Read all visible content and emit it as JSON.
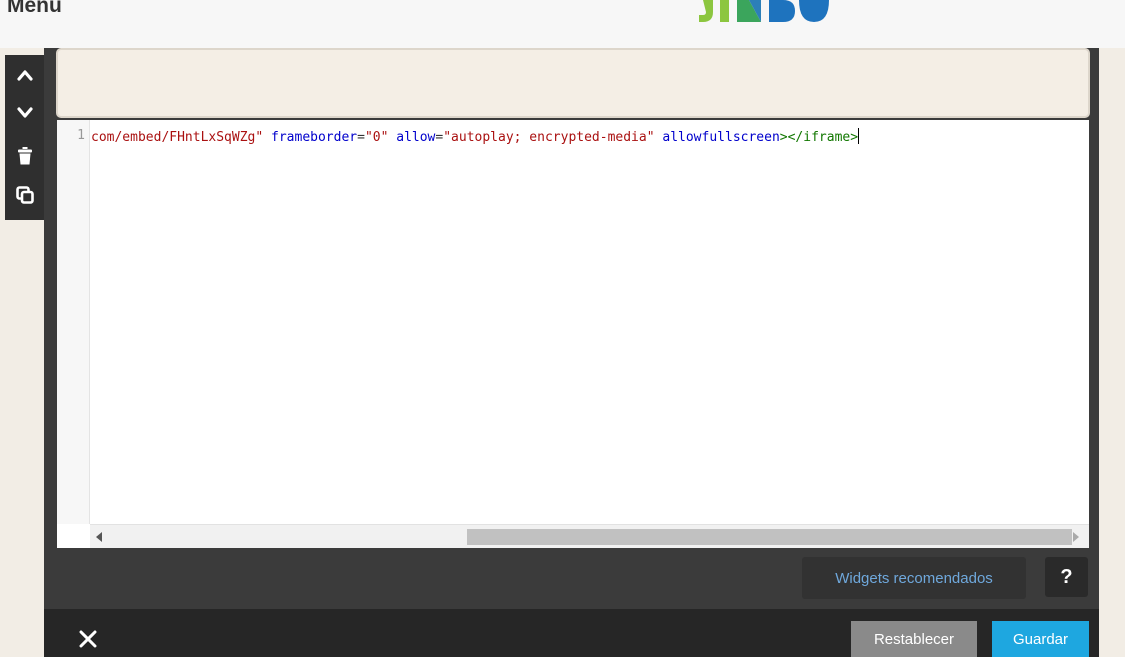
{
  "header": {
    "menu_label": "Menu",
    "logo": "jimdo-logo"
  },
  "toolbar": {
    "move_up": "chevron-up-icon",
    "move_down": "chevron-down-icon",
    "delete": "trash-icon",
    "duplicate": "copy-icon"
  },
  "editor": {
    "line_number": "1",
    "code": {
      "src_tail": "com/embed/FHntLxSqWZg\"",
      "frameborder_attr": "frameborder",
      "frameborder_val": "\"0\"",
      "allow_attr": "allow",
      "allow_val": "\"autoplay; encrypted-media\"",
      "allowfullscreen_attr": "allowfullscreen",
      "close_tag": "></iframe>"
    }
  },
  "controls": {
    "widgets_label": "Widgets recomendados",
    "help_label": "?",
    "reset_label": "Restablecer",
    "save_label": "Guardar"
  },
  "colors": {
    "dark_panel": "#3b3b3b",
    "footer": "#262626",
    "save_button": "#1ea7e0",
    "reset_button": "#8a8a8a",
    "page_beige": "#f2ede5",
    "link_blue": "#6fa8dc"
  }
}
